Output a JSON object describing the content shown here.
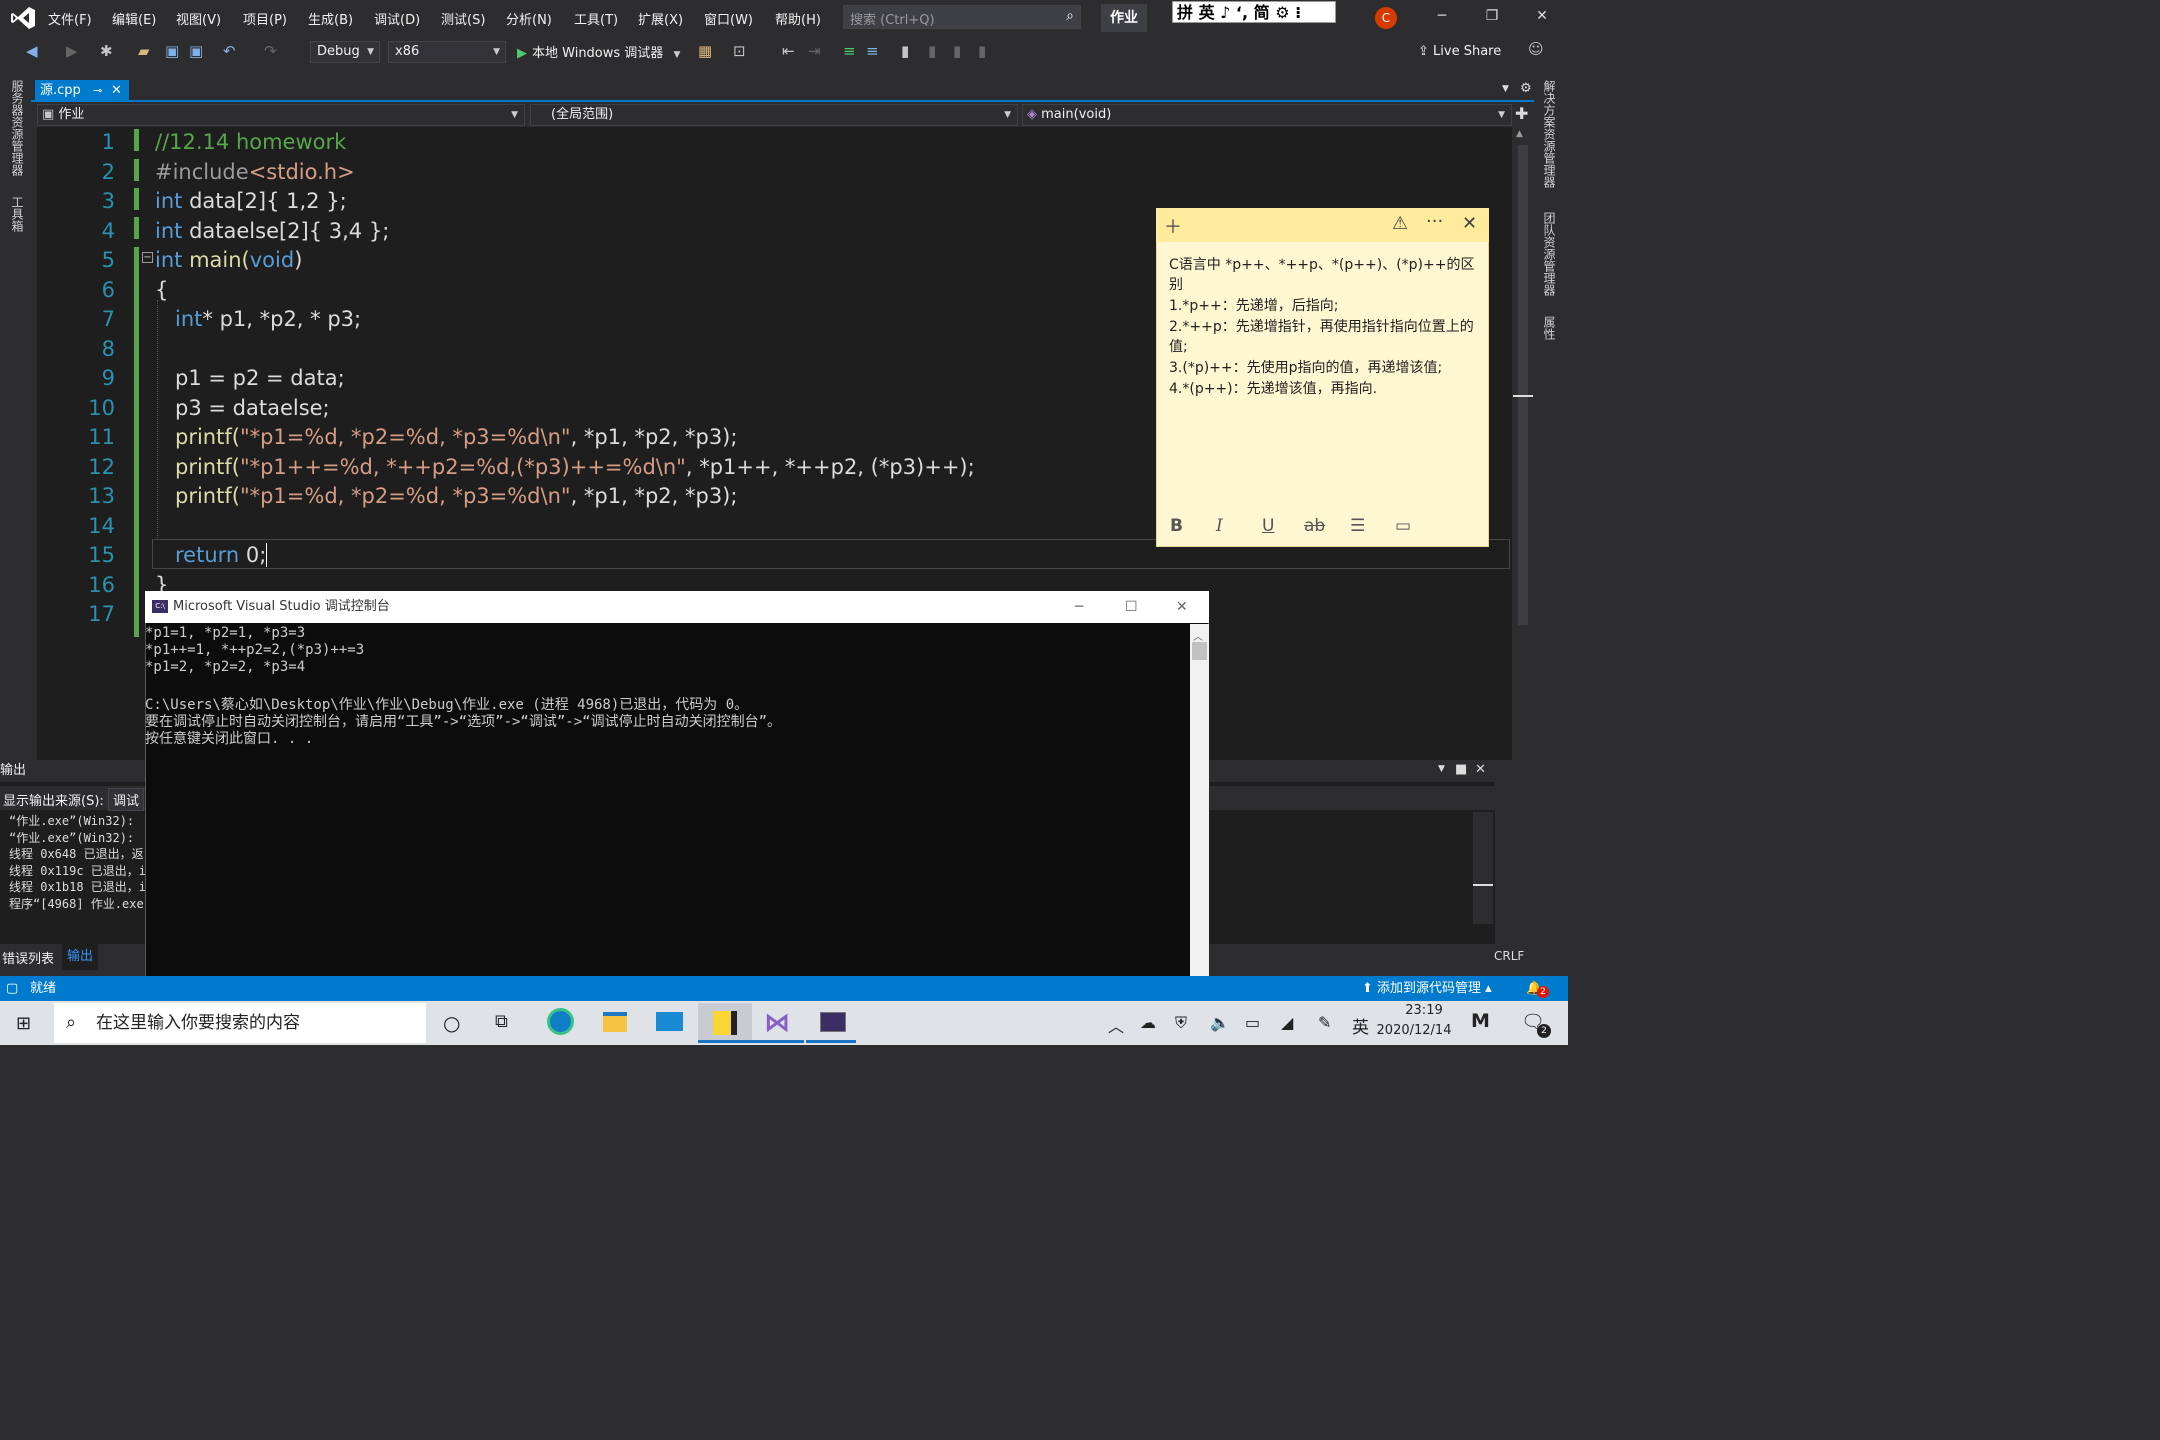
{
  "menu": [
    "文件(F)",
    "编辑(E)",
    "视图(V)",
    "项目(P)",
    "生成(B)",
    "调试(D)",
    "测试(S)",
    "分析(N)",
    "工具(T)",
    "扩展(X)",
    "窗口(W)",
    "帮助(H)"
  ],
  "search": {
    "placeholder": "搜索 (Ctrl+Q)"
  },
  "project_name": "作业",
  "ime_bar": "拼 英 ♪ ‘, 简 ⚙ ⁝",
  "user_initial": "C",
  "toolbar": {
    "config": "Debug",
    "platform": "x86",
    "run_label": "本地 Windows 调试器",
    "live_share": "Live Share"
  },
  "left_strip": {
    "server_explorer": "服务器资源管理器",
    "toolbox": "工具箱"
  },
  "right_strip": {
    "solution_explorer": "解决方案资源管理器",
    "team_explorer": "团队资源管理器",
    "properties": "属性"
  },
  "tab": {
    "filename": "源.cpp"
  },
  "navbar": {
    "project": "作业",
    "scope": "(全局范围)",
    "member": "main(void)"
  },
  "editor": {
    "line_numbers": [
      "1",
      "2",
      "3",
      "4",
      "5",
      "6",
      "7",
      "8",
      "9",
      "10",
      "11",
      "12",
      "13",
      "14",
      "15",
      "16",
      "17"
    ],
    "lines": {
      "l1": "//12.14 homework",
      "l2a": "#include",
      "l2b": "<stdio.h>",
      "l3a": "int",
      "l3b": " data[2]{ 1,2 };",
      "l4a": "int",
      "l4b": " dataelse[2]{ 3,4 };",
      "l5a": "int",
      "l5b": " main(",
      "l5c": "void",
      "l5d": ")",
      "l6": "{",
      "l7a": "int",
      "l7b": "* p1, *p2, * p3;",
      "l9": "p1 = p2 = data;",
      "l10": "p3 = dataelse;",
      "l11a": "printf(",
      "l11b": "\"*p1=%d, *p2=%d, *p3=%d\\n\"",
      "l11c": ", *p1, *p2, *p3);",
      "l12a": "printf(",
      "l12b": "\"*p1++=%d, *++p2=%d,(*p3)++=%d\\n\"",
      "l12c": ", *p1++, *++p2, (*p3)++);",
      "l13a": "printf(",
      "l13b": "\"*p1=%d, *p2=%d, *p3=%d\\n\"",
      "l13c": ", *p1, *p2, *p3);",
      "l15a": "return",
      "l15b": " 0;",
      "l16": "}"
    }
  },
  "sticky": {
    "lines": [
      "C语言中 *p++、*++p、*(p++)、(*p)++的区别",
      "1.*p++：先递增，后指向;",
      "2.*++p：先递增指针，再使用指针指向位置上的值;",
      "3.(*p)++：先使用p指向的值，再递增该值;",
      "4.*(p++)：先递增该值，再指向."
    ]
  },
  "output": {
    "title": "输出",
    "source_label": "显示输出来源(S):",
    "source_value": "调试",
    "lines": [
      "“作业.exe”(Win32):",
      "“作业.exe”(Win32):",
      "线程 0x648 已退出，返",
      "线程 0x119c 已退出，i",
      "线程 0x1b18 已退出，i",
      "程序“[4968] 作业.exe"
    ],
    "tabs": [
      "错误列表",
      "输出"
    ]
  },
  "console": {
    "title": "Microsoft Visual Studio 调试控制台",
    "lines": [
      "*p1=1, *p2=1, *p3=3",
      "*p1++=1, *++p2=2,(*p3)++=3",
      "*p1=2, *p2=2, *p3=4",
      "",
      "C:\\Users\\蔡心如\\Desktop\\作业\\作业\\Debug\\作业.exe (进程 4968)已退出，代码为 0。",
      "要在调试停止时自动关闭控制台，请启用“工具”->“选项”->“调试”->“调试停止时自动关闭控制台”。",
      "按任意键关闭此窗口. . ."
    ]
  },
  "statusbar": {
    "ready": "就绪",
    "source_control": "添加到源代码管理",
    "line_ending": "CRLF",
    "notifications": "2"
  },
  "taskbar": {
    "search_placeholder": "在这里输入你要搜索的内容",
    "ime": "英",
    "time": "23:19",
    "date": "2020/12/14",
    "notification_count": "2"
  },
  "colors": {
    "accent": "#007acc",
    "editor_bg": "#1e1e1e",
    "keyword": "#569cd6",
    "comment": "#57a64a",
    "string": "#d69d85",
    "sticky_bg": "#fff7d1"
  }
}
